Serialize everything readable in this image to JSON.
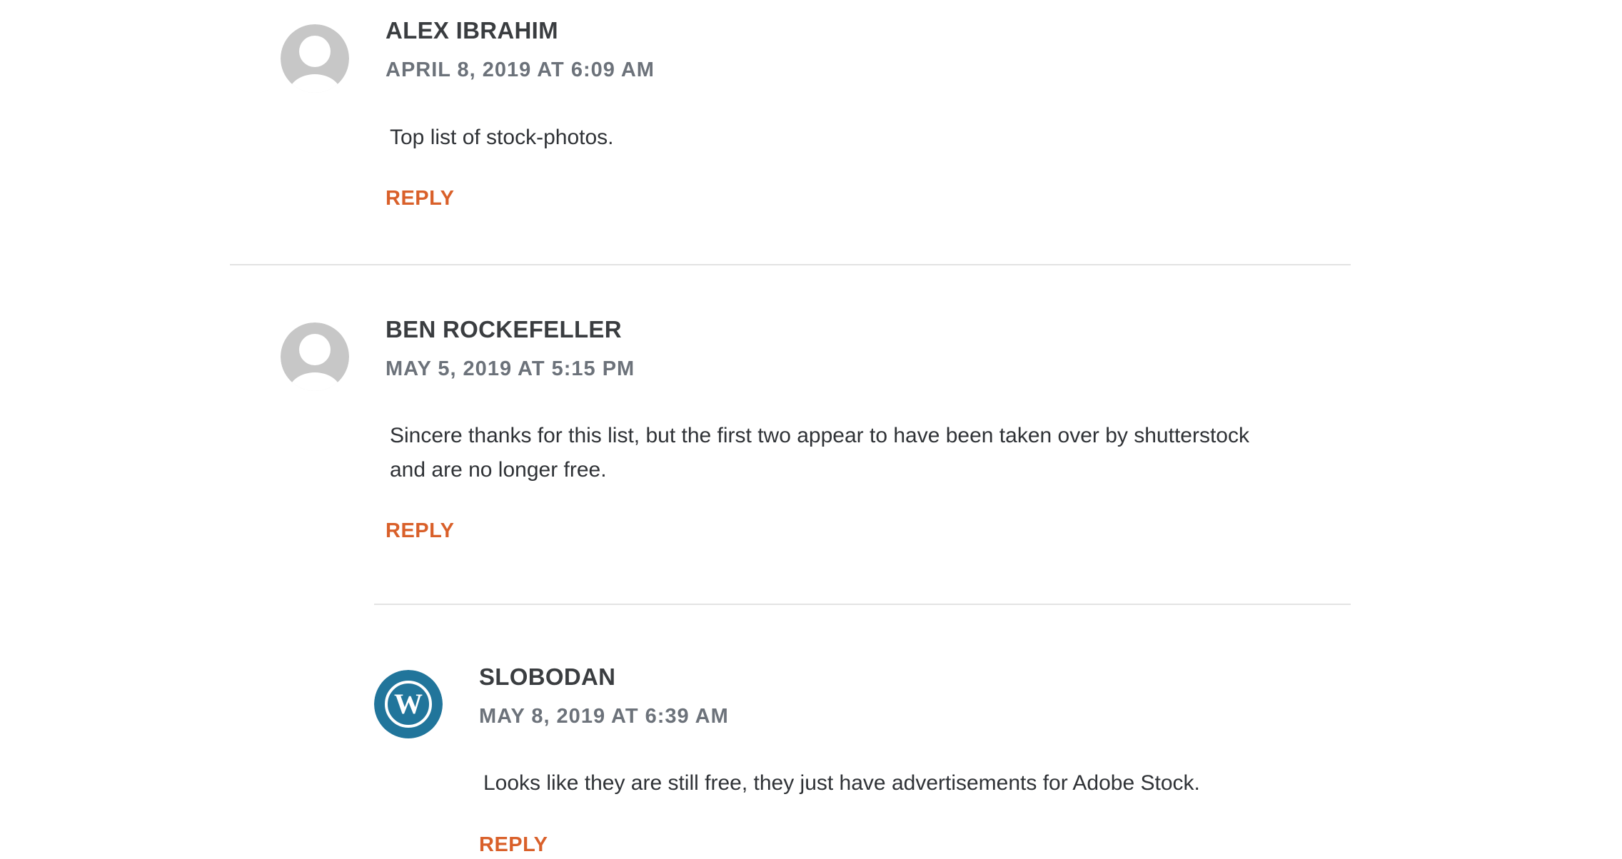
{
  "comments": [
    {
      "author": "ALEX IBRAHIM",
      "date": "APRIL 8, 2019 AT 6:09 AM",
      "text": "Top list of stock-photos.",
      "reply_label": "REPLY",
      "avatar": "default-avatar-icon"
    },
    {
      "author": "BEN ROCKEFELLER",
      "date": "MAY 5, 2019 AT 5:15 PM",
      "text": "Sincere thanks for this list, but the first two appear to have been taken over by shutterstock and are no longer free.",
      "reply_label": "REPLY",
      "avatar": "default-avatar-icon"
    },
    {
      "author": "SLOBODAN",
      "date": "MAY 8, 2019 AT 6:39 AM",
      "text": "Looks like they are still free, they just have advertisements for Adobe Stock.",
      "reply_label": "REPLY",
      "avatar": "wordpress-logo-icon"
    }
  ],
  "colors": {
    "reply": "#d9602a",
    "author": "#3a3d40",
    "date": "#6c727a",
    "wordpress_blue": "#21759b",
    "avatar_gray": "#c7c7c7",
    "divider": "#e3e3e3"
  }
}
